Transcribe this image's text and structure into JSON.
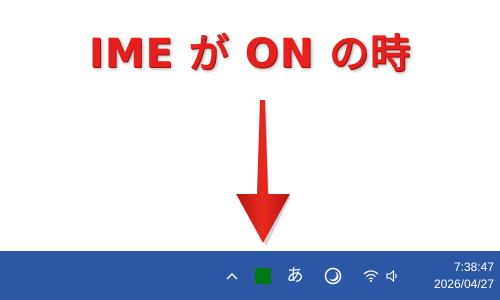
{
  "headline": {
    "text": "IME が ON の時",
    "color": "#e8201d"
  },
  "annotation": {
    "arrow_color": "#d7231c",
    "arrow_icon": "arrow-down-icon"
  },
  "taskbar": {
    "background": "#2b58a4",
    "tray": {
      "show_hidden_icon": "chevron-up-icon",
      "ime_status_color": "#007a10",
      "ime_mode_label": "あ",
      "night_light_icon": "moon-clock-icon",
      "network_icon": "wifi-icon",
      "volume_icon": "speaker-icon"
    },
    "clock": {
      "time": "7:38:47",
      "date": "2026/04/27"
    }
  }
}
